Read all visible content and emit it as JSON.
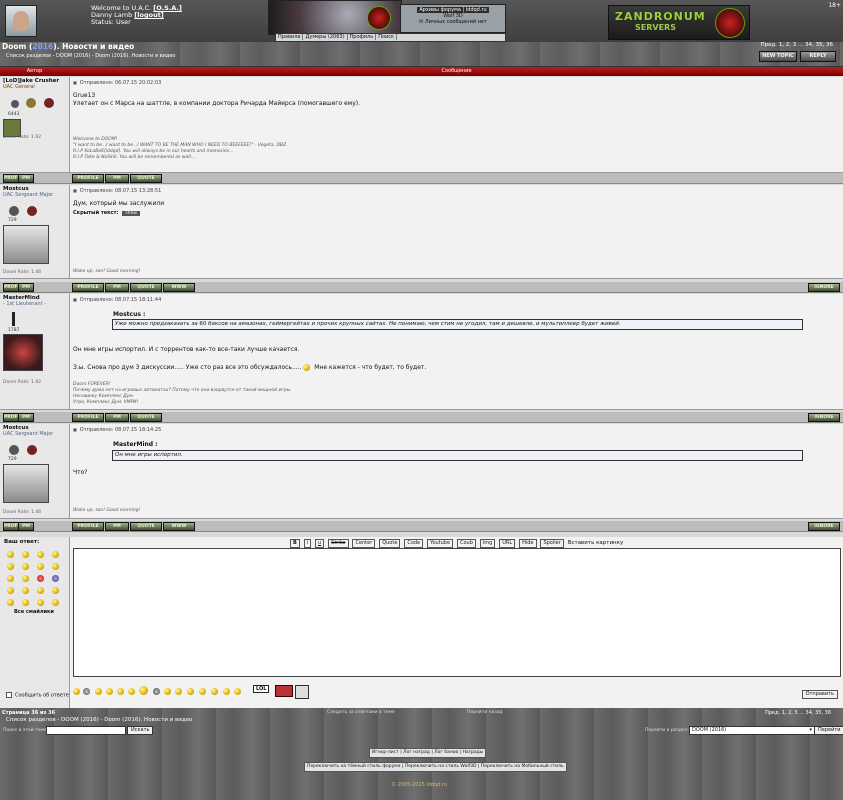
{
  "header": {
    "welcome": "Welcome to U.A.C.",
    "welcome_tag": "[O.S.A.]",
    "username": "Danny Lamb",
    "logout": "[logout]",
    "status": "Status: User",
    "age_badge": "18+",
    "archive_title": "Архивы форума | iddqd.ru",
    "archive_sub": "Wolf 3D",
    "private_messages": "Личных сообщений нет",
    "right_logo_line1": "ZANDRONUM",
    "right_logo_line2": "SERVERS",
    "nav": [
      "Правила",
      "Думеры (2063)",
      "Профиль",
      "Поиск"
    ]
  },
  "titlebar": {
    "title_pre": "Doom (",
    "title_year": "2016",
    "title_post": "). Новости и видео",
    "breadcrumb": "Список разделов - DOOM (2016) - Doom (2016). Новости и видео",
    "pages": "Пред. 1, 2, 3 ... 34, 35, 36",
    "new_topic": "NEW TOPIC",
    "reply": "REPLY"
  },
  "table_header": {
    "author": "Автор",
    "message": "Сообщение"
  },
  "posts": [
    {
      "author": "[LoD]Jake Crusher",
      "rank": "UAC General",
      "count": "6443",
      "rate": "Doom Rate: 1.92",
      "date": "Отправлено: 06.07.15 20:02:03",
      "line1": "Grue13",
      "line2": "Улетает он с Марса на шаттле, в компании доктора Ричарда Майерса (помогавшего ему).",
      "sig": [
        "Welcome to DOOM!",
        "\"I want to be...I want to be...I WANT TO BE THE MAN WHO I NEED TO BEEEEEE!\" - Vegeta, DBZ.",
        "",
        "R.I.P KoLoBoK[iddqd]. You will allways be in our hearts and memories...",
        "R.I.P Toke & NoSkill. You will be remembered as well..."
      ]
    },
    {
      "author": "Mostcus",
      "rank": "UAC Sergeant Major",
      "count": "729",
      "rate": "Doom Rate: 1.46",
      "date": "Отправлено: 08.07.15 13:28:51",
      "line1": "Дум, который мы заслужили",
      "hidden_label": "Скрытый текст:",
      "hidden_btn": "show",
      "sig": [
        "Wake up, son! Good morning!"
      ]
    },
    {
      "author": "MasterMind",
      "rank": "- 1st Lieutenant -",
      "count": "1787",
      "rate": "Doom Rate: 1.92",
      "date": "Отправлено: 08.07.15 18:11:44",
      "quote_author": "Mostcus :",
      "quote_text": "Уже можно предзаказать за 60 баксов на амазонах, геймергейтах и прочих крупных сайтах. Не понимаю, чем стим не угодил, там и дешевле, и мультиплеер будет живей.",
      "line1": "Он мне игры испортил. И с торрентов как-то все-таки лучше качается.",
      "line2": "З.ы. Снова про дум 3 дискуссии..... Уже сто раз все это обсуждалось.....",
      "line3": "Мне кажется - что будет, то будет.",
      "sig": [
        "Doom FOREVER!",
        "Почему дума нет на игровых автоматах? Потому что они взорвутся от такой мощной игры.",
        "Ненавижу Комплекс Дум.",
        "Утрo, Комплекс Дум. УМРИ!"
      ]
    },
    {
      "author": "Mostcus",
      "rank": "UAC Sergeant Major",
      "count": "729",
      "rate": "Doom Rate: 1.46",
      "date": "Отправлено: 08.07.15 18:14:25",
      "quote_author": "MasterMind :",
      "quote_text": "Он мне игры испортил.",
      "line1": "Что?",
      "sig": [
        "Wake up, son! Good morning!"
      ]
    }
  ],
  "tool_labels": {
    "profile": "PROFILE",
    "pm": "PM",
    "quote": "QUOTE",
    "www": "WWW",
    "ignore": "IGNORE"
  },
  "reply": {
    "label": "Ваш ответ:",
    "all_smilies": "Все смайлики",
    "bb": [
      "B",
      "i",
      "u",
      "Strike",
      "Center",
      "Quote",
      "Code",
      "Youtube",
      "Coub",
      "Img",
      "URL",
      "Hide",
      "Spoiler"
    ],
    "insert_pic": "Вставить картинку",
    "notify": "Сообщить об ответе",
    "send": "Отправить",
    "lol": "LOL"
  },
  "footer": {
    "page": "Страница 36 из 36",
    "breadcrumb": "Список разделов - DOOM (2016) - Doom (2016). Новости и видео",
    "track": "Следить за ответами в теме",
    "prev_topic": "Перейти назад",
    "pages": "Пред. 1, 2, 3 ... 34, 35, 36",
    "search_label": "Поиск в этой теме:",
    "search_btn": "Искать",
    "goto_label": "Перейти в раздел:",
    "goto_value": "DOOM (2016)",
    "goto_btn": "Перейти",
    "links": "Игнор-лист | Лог наград | Лог банов | Награды",
    "styles": "Переключить на тёмный стиль форума | Переключить на стиль Wolf3D | Переключить на Мобильный стиль",
    "copyright": "© 2005-2015 iddqd.ru"
  },
  "colors": {
    "header_red": "#9a0f0f",
    "quote_bg": "#eef2f6",
    "accent_green": "#9ccc4a"
  }
}
